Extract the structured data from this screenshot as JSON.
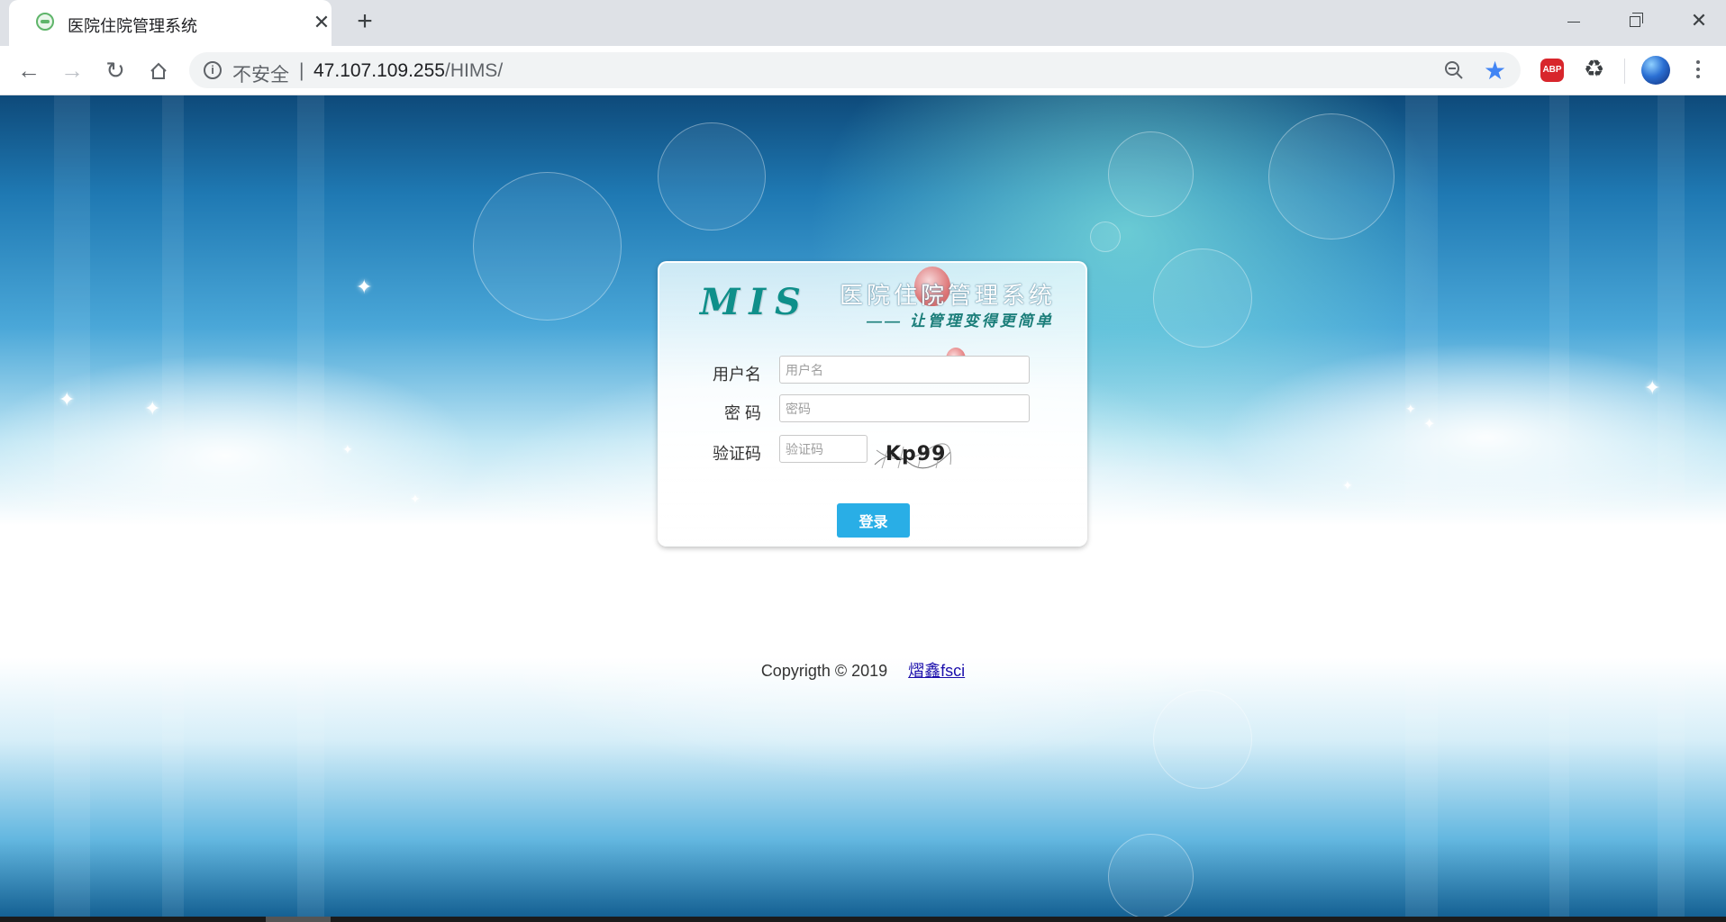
{
  "browser": {
    "tab_title": "医院住院管理系统",
    "tab_close": "✕",
    "new_tab": "+",
    "security_label": "不安全",
    "separator": "|",
    "url_host": "47.107.109.255",
    "url_path": "/HIMS/",
    "extensions": {
      "abp": "ABP"
    },
    "icons": [
      "back-arrow-icon",
      "forward-arrow-icon",
      "reload-icon",
      "home-icon",
      "info-icon",
      "zoom-out-icon",
      "bookmark-star-icon",
      "adblock-icon",
      "recycle-extension-icon",
      "profile-avatar-icon",
      "more-menu-icon"
    ]
  },
  "login": {
    "logo_mis": "MIS",
    "system_title": "医院住院管理系统",
    "slogan": "—— 让管理变得更简单",
    "username_label": "用户名",
    "username_placeholder": "用户名",
    "password_label": "密 码",
    "password_placeholder": "密码",
    "captcha_label": "验证码",
    "captcha_placeholder": "验证码",
    "captcha_text": "Kp99",
    "submit_label": "登录",
    "button_color": "#29aee6"
  },
  "footer": {
    "copyright": "Copyrigth © 2019",
    "link_text": "熠鑫fsci"
  }
}
